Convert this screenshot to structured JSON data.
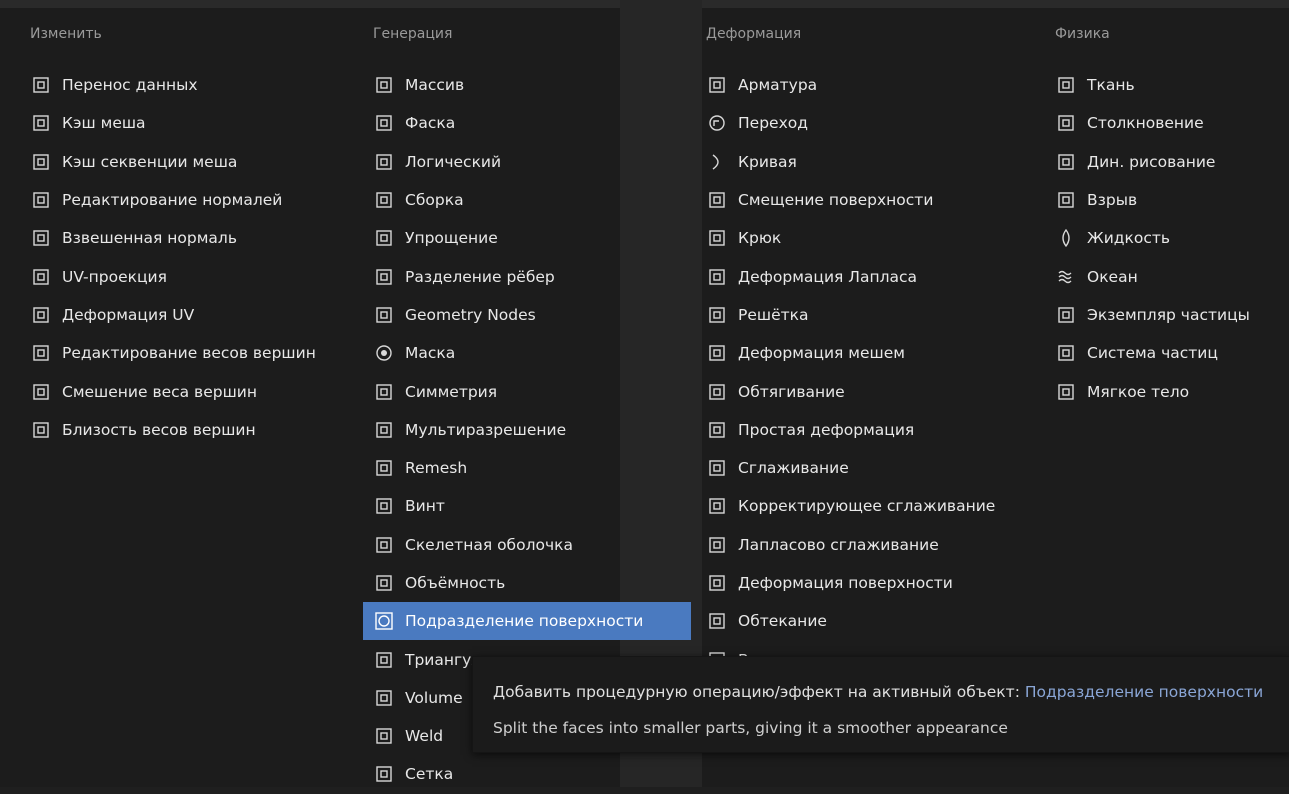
{
  "columns": [
    {
      "header": "Изменить",
      "items": [
        {
          "label": "Перенос данных",
          "icon": "data-transfer-icon"
        },
        {
          "label": "Кэш меша",
          "icon": "mesh-cache-icon"
        },
        {
          "label": "Кэш секвенции меша",
          "icon": "mesh-sequence-cache-icon"
        },
        {
          "label": "Редактирование нормалей",
          "icon": "normal-edit-icon"
        },
        {
          "label": "Взвешенная нормаль",
          "icon": "weighted-normal-icon"
        },
        {
          "label": "UV-проекция",
          "icon": "uv-project-icon"
        },
        {
          "label": "Деформация UV",
          "icon": "uv-warp-icon"
        },
        {
          "label": "Редактирование весов вершин",
          "icon": "vertex-weight-edit-icon"
        },
        {
          "label": "Смешение веса вершин",
          "icon": "vertex-weight-mix-icon"
        },
        {
          "label": "Близость весов вершин",
          "icon": "vertex-weight-proximity-icon"
        }
      ]
    },
    {
      "header": "Генерация",
      "items": [
        {
          "label": "Массив",
          "icon": "array-icon"
        },
        {
          "label": "Фаска",
          "icon": "bevel-icon"
        },
        {
          "label": "Логический",
          "icon": "boolean-icon"
        },
        {
          "label": "Сборка",
          "icon": "build-icon"
        },
        {
          "label": "Упрощение",
          "icon": "decimate-icon"
        },
        {
          "label": "Разделение рёбер",
          "icon": "edge-split-icon"
        },
        {
          "label": "Geometry Nodes",
          "icon": "geometry-nodes-icon"
        },
        {
          "label": "Маска",
          "icon": "mask-icon"
        },
        {
          "label": "Симметрия",
          "icon": "mirror-icon"
        },
        {
          "label": "Мультиразрешение",
          "icon": "multires-icon"
        },
        {
          "label": "Remesh",
          "icon": "remesh-icon"
        },
        {
          "label": "Винт",
          "icon": "screw-icon"
        },
        {
          "label": "Скелетная оболочка",
          "icon": "skin-icon"
        },
        {
          "label": "Объёмность",
          "icon": "solidify-icon"
        },
        {
          "label": "Подразделение поверхности",
          "icon": "subdivision-icon",
          "active": true
        },
        {
          "label": "Триангуляция",
          "icon": "triangulate-icon"
        },
        {
          "label": "Volume",
          "icon": "volume-icon"
        },
        {
          "label": "Weld",
          "icon": "weld-icon"
        },
        {
          "label": "Сетка",
          "icon": "wireframe-icon"
        }
      ]
    },
    {
      "header": "Деформация",
      "items": [
        {
          "label": "Арматура",
          "icon": "armature-icon"
        },
        {
          "label": "Переход",
          "icon": "cast-icon"
        },
        {
          "label": "Кривая",
          "icon": "curve-icon"
        },
        {
          "label": "Смещение поверхности",
          "icon": "displace-icon"
        },
        {
          "label": "Крюк",
          "icon": "hook-icon"
        },
        {
          "label": "Деформация Лапласа",
          "icon": "laplacian-deform-icon"
        },
        {
          "label": "Решётка",
          "icon": "lattice-icon"
        },
        {
          "label": "Деформация мешем",
          "icon": "mesh-deform-icon"
        },
        {
          "label": "Обтягивание",
          "icon": "shrinkwrap-icon"
        },
        {
          "label": "Простая деформация",
          "icon": "simple-deform-icon"
        },
        {
          "label": "Сглаживание",
          "icon": "smooth-icon"
        },
        {
          "label": "Корректирующее сглаживание",
          "icon": "corrective-smooth-icon"
        },
        {
          "label": "Лапласово сглаживание",
          "icon": "laplacian-smooth-icon"
        },
        {
          "label": "Деформация поверхности",
          "icon": "surface-deform-icon"
        },
        {
          "label": "Обтекание",
          "icon": "warp-icon"
        },
        {
          "label": "Волна",
          "icon": "wave-icon"
        }
      ]
    },
    {
      "header": "Физика",
      "items": [
        {
          "label": "Ткань",
          "icon": "cloth-icon"
        },
        {
          "label": "Столкновение",
          "icon": "collision-icon"
        },
        {
          "label": "Дин. рисование",
          "icon": "dynamic-paint-icon"
        },
        {
          "label": "Взрыв",
          "icon": "explode-icon"
        },
        {
          "label": "Жидкость",
          "icon": "fluid-icon"
        },
        {
          "label": "Океан",
          "icon": "ocean-icon"
        },
        {
          "label": "Экземпляр частицы",
          "icon": "particle-instance-icon"
        },
        {
          "label": "Система частиц",
          "icon": "particle-system-icon"
        },
        {
          "label": "Мягкое тело",
          "icon": "soft-body-icon"
        }
      ]
    }
  ],
  "tooltip": {
    "prefix": "Добавить процедурную операцию/эффект на активный объект: ",
    "target": "Подразделение поверхности",
    "description": "Split the faces into smaller parts, giving it a smoother appearance"
  },
  "colors": {
    "accent": "#4a7ac0",
    "background": "#1c1c1c",
    "tooltip_link": "#8aa6d6"
  }
}
